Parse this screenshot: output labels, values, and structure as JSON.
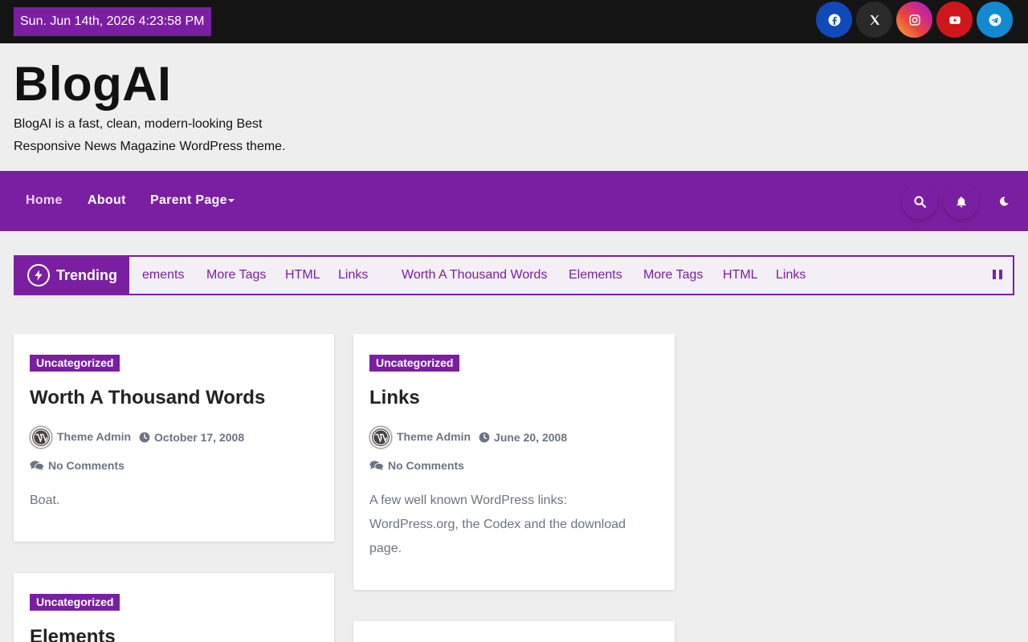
{
  "topbar": {
    "datetime": "Sun. Jun 14th, 2026 4:23:58 PM",
    "social": [
      {
        "icon": "facebook-icon",
        "color": "#1049b8"
      },
      {
        "icon": "x-twitter-icon",
        "color": "#2a2a2a"
      },
      {
        "icon": "instagram-icon",
        "color": "#c7249c"
      },
      {
        "icon": "youtube-icon",
        "color": "#d0161d"
      },
      {
        "icon": "telegram-icon",
        "color": "#118ad1"
      }
    ]
  },
  "site": {
    "title": "BlogAI",
    "description": "BlogAI is a fast, clean, modern-looking Best Responsive News Magazine WordPress theme."
  },
  "nav": {
    "items": [
      {
        "label": "Home"
      },
      {
        "label": "About"
      },
      {
        "label": "Parent Page"
      }
    ],
    "icons": [
      "search-icon",
      "bell-icon",
      "moon-icon"
    ],
    "accent": "#7b1fa2"
  },
  "trending": {
    "label": "Trending",
    "items": [
      "ements",
      "More Tags",
      "HTML",
      "Links",
      "Worth A Thousand Words",
      "Elements",
      "More Tags",
      "HTML",
      "Links"
    ]
  },
  "posts": [
    {
      "category": "Uncategorized",
      "title": "Worth A Thousand Words",
      "author": "Theme Admin",
      "date": "October 17, 2008",
      "comments": "No Comments",
      "excerpt": "Boat."
    },
    {
      "category": "Uncategorized",
      "title": "Links",
      "author": "Theme Admin",
      "date": "June 20, 2008",
      "comments": "No Comments",
      "excerpt": "A few well known WordPress links: WordPress.org, the Codex and the download page."
    },
    {
      "category": "Uncategorized",
      "title": "Elements"
    }
  ]
}
